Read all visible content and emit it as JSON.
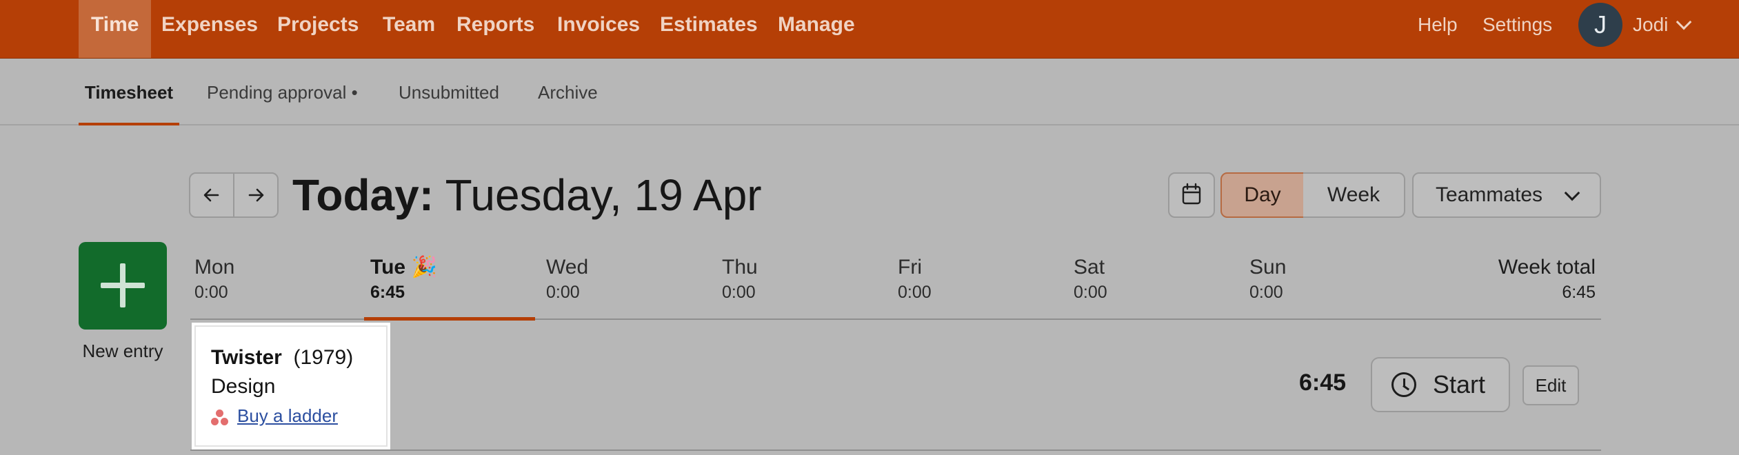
{
  "nav": {
    "items": [
      "Time",
      "Expenses",
      "Projects",
      "Team",
      "Reports",
      "Invoices",
      "Estimates",
      "Manage"
    ],
    "right": {
      "help": "Help",
      "settings": "Settings",
      "avatar_initial": "J",
      "user_name": "Jodi"
    }
  },
  "subnav": {
    "tabs": [
      "Timesheet",
      "Pending approval •",
      "Unsubmitted",
      "Archive"
    ]
  },
  "header": {
    "title_prefix": "Today:",
    "title_date": "Tuesday, 19 Apr",
    "view_day": "Day",
    "view_week": "Week",
    "teammates": "Teammates"
  },
  "new_entry": {
    "label": "New entry"
  },
  "days": [
    {
      "name": "Mon",
      "total": "0:00"
    },
    {
      "name": "Tue 🎉",
      "total": "6:45"
    },
    {
      "name": "Wed",
      "total": "0:00"
    },
    {
      "name": "Thu",
      "total": "0:00"
    },
    {
      "name": "Fri",
      "total": "0:00"
    },
    {
      "name": "Sat",
      "total": "0:00"
    },
    {
      "name": "Sun",
      "total": "0:00"
    }
  ],
  "week_total": {
    "label": "Week total",
    "value": "6:45"
  },
  "entry": {
    "project": "Twister",
    "client": "(1979)",
    "task": "Design",
    "link": "Buy a ladder",
    "time": "6:45",
    "start_label": "Start",
    "edit_label": "Edit"
  },
  "colors": {
    "brand": "#b53f06",
    "new_entry": "#126b2b",
    "link": "#2c4fa0"
  }
}
